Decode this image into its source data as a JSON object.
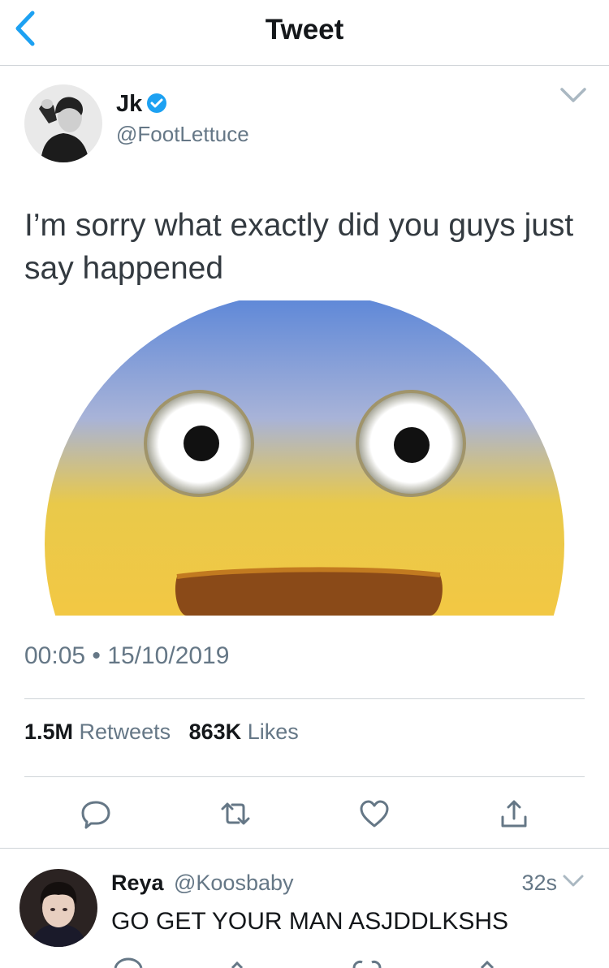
{
  "nav": {
    "title": "Tweet",
    "back_icon": "chevron-left-icon"
  },
  "tweet": {
    "author_name": "Jk",
    "author_handle": "@FootLettuce",
    "verified_icon": "verified-badge-icon",
    "text": "I’m sorry what exactly did you guys just say happened",
    "media": "scared-face-emoji-image",
    "time": "00:05",
    "separator": "•",
    "date": "15/10/2019",
    "retweets_count": "1.5M",
    "retweets_label": "Retweets",
    "likes_count": "863K",
    "likes_label": "Likes",
    "actions": [
      "reply-icon",
      "retweet-icon",
      "like-icon",
      "share-icon"
    ]
  },
  "reply": {
    "author_name": "Reya",
    "author_handle": "@Koosbaby",
    "time": "32s",
    "text": "GO GET YOUR MAN ASJDDLKSHS"
  },
  "colors": {
    "accent": "#1da1f2",
    "secondary_text": "#657786",
    "divider": "#cfd4d8"
  }
}
